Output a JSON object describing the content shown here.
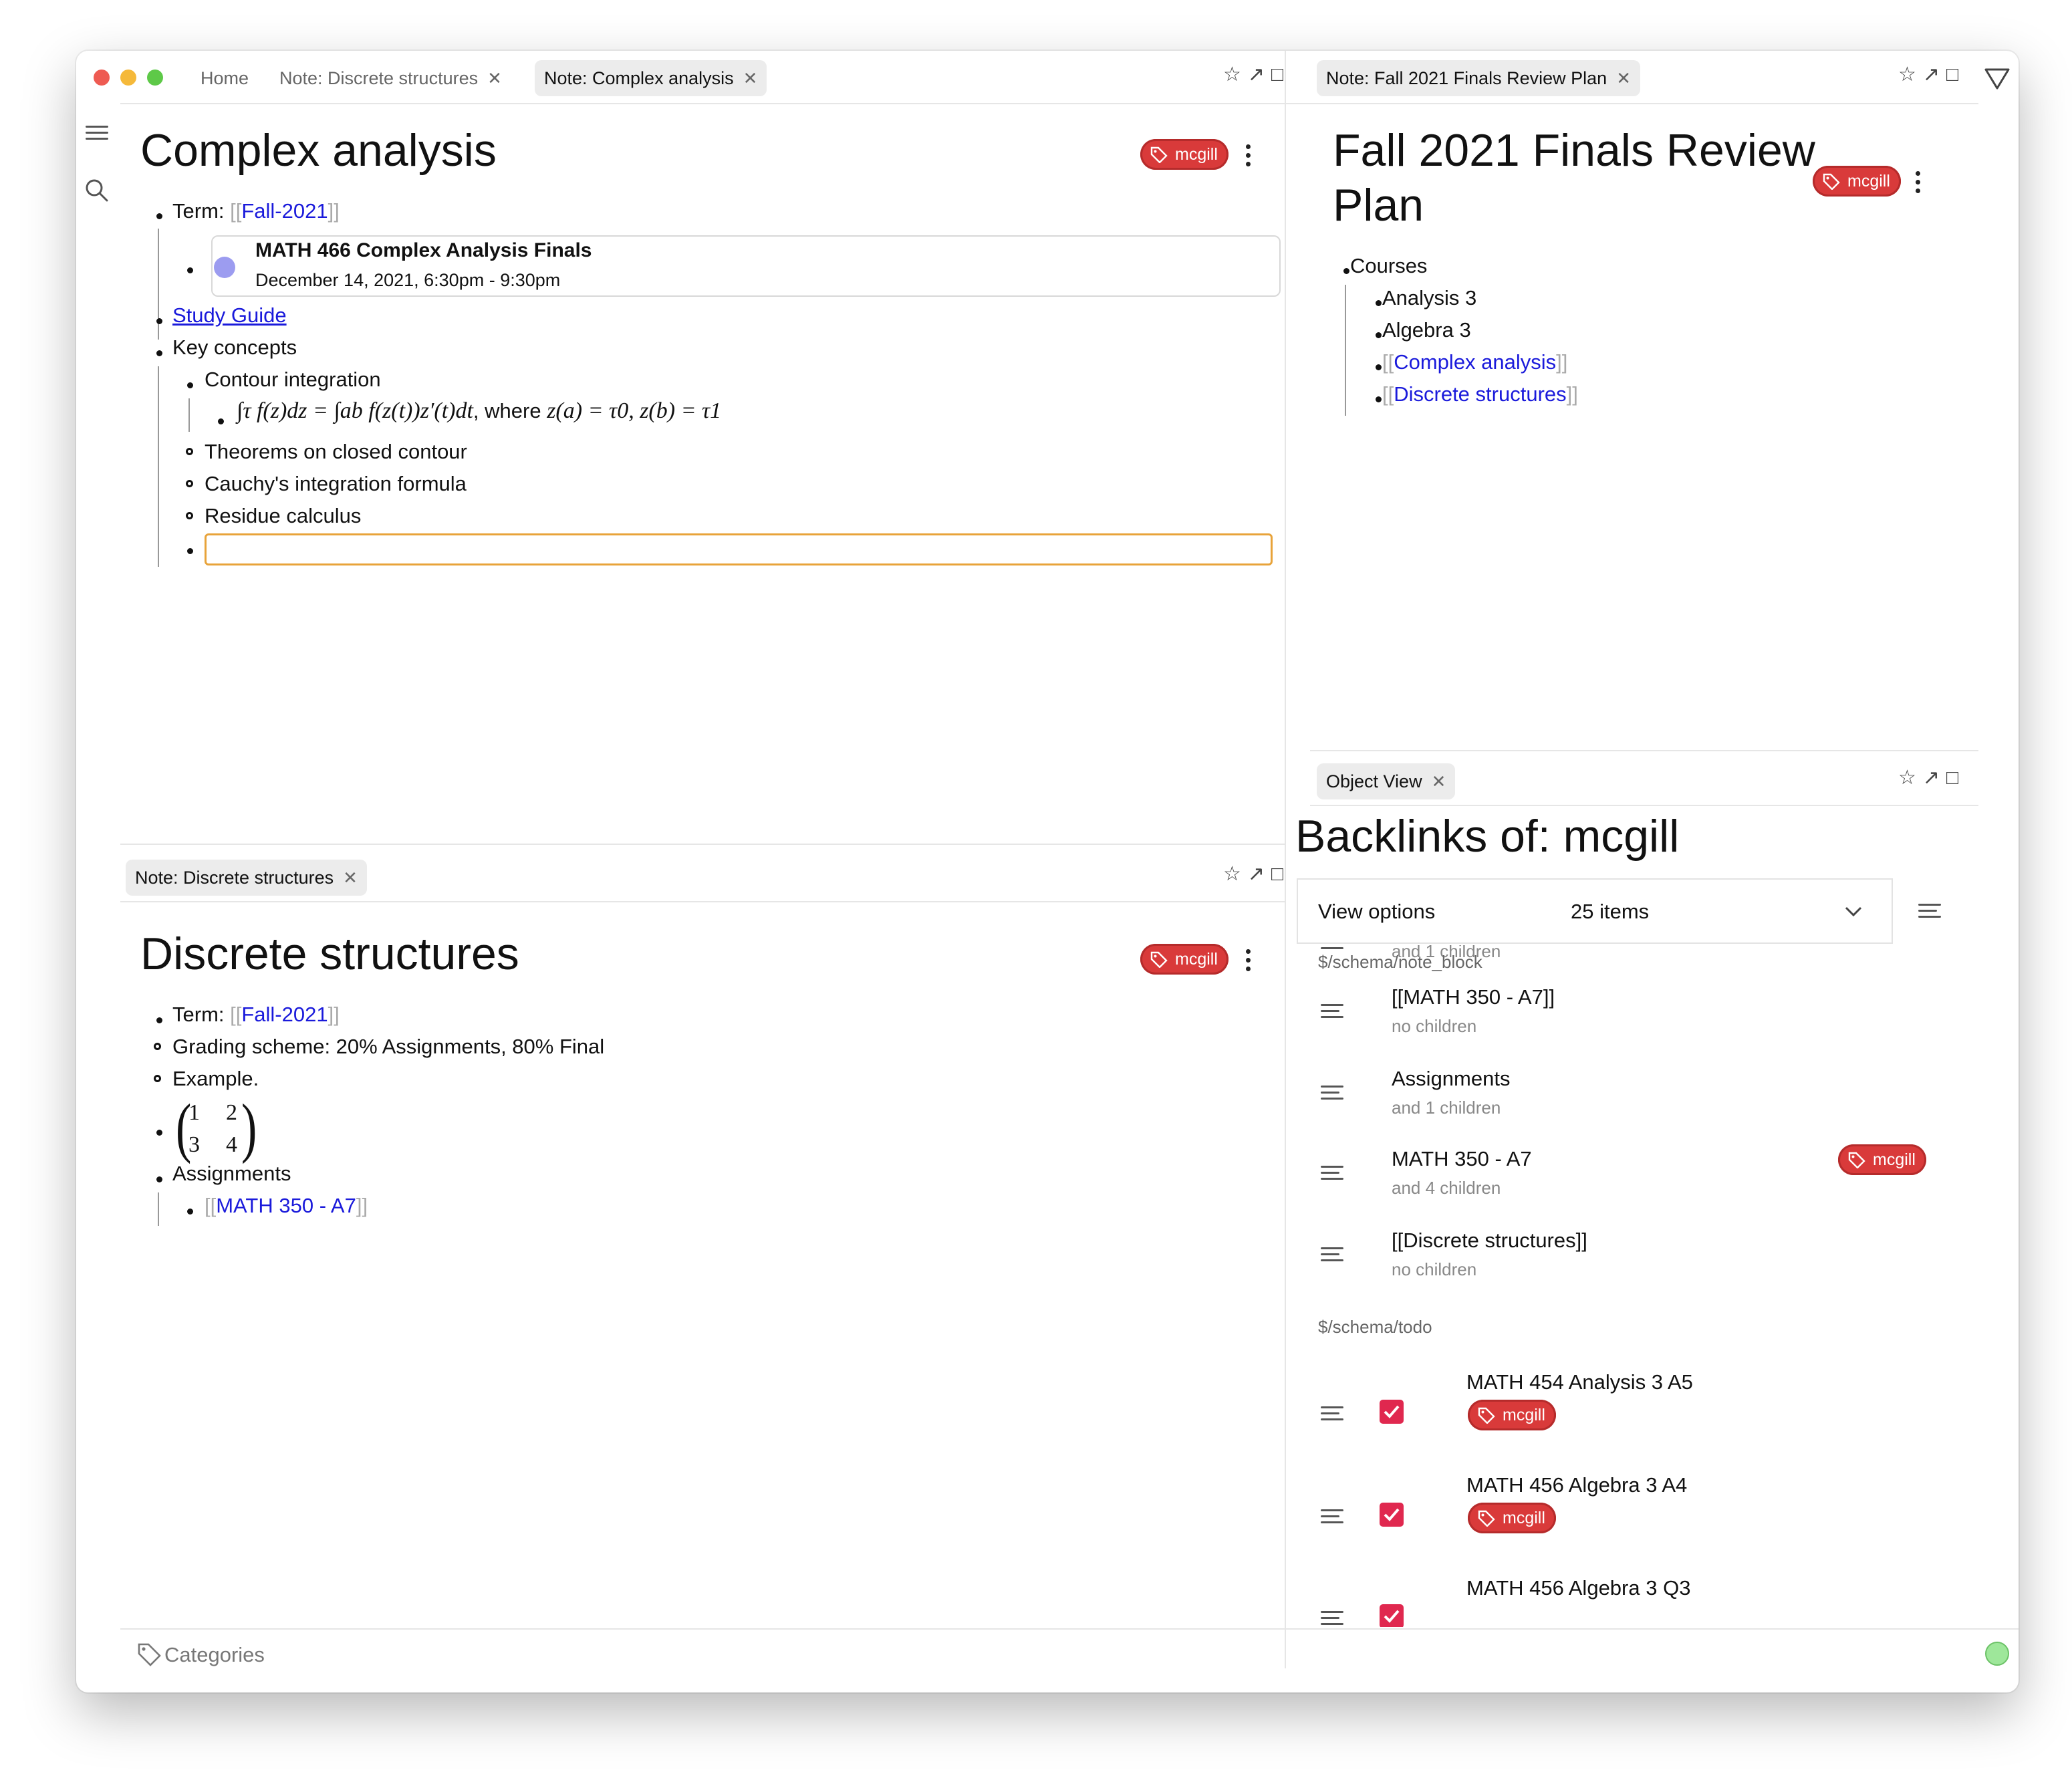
{
  "colors": {
    "tag_red": "#d93a3a",
    "link_blue": "#1a1adb",
    "focus_orange": "#e8a33a",
    "status_green": "#9ee79a",
    "event_dot": "#9c9cf0",
    "checkbox": "#e0284f"
  },
  "left_tabs": {
    "home": "Home",
    "discrete": "Note: Discrete structures",
    "complex": "Note: Complex analysis",
    "close": "✕"
  },
  "complex": {
    "title": "Complex analysis",
    "tag": "mcgill",
    "term_label": "Term: ",
    "term_link": "Fall-2021",
    "event_title": "MATH 466 Complex Analysis Finals",
    "event_time": "December 14, 2021, 6:30pm - 9:30pm",
    "study_guide": "Study Guide",
    "key_concepts": "Key concepts",
    "contour": "Contour integration",
    "formula_text": ", where ",
    "formula_lhs": "∫τ f(z)dz = ∫ab f(z(t))z′(t)dt",
    "formula_rhs": "z(a) = τ0, z(b) = τ1",
    "theorems": "Theorems on closed contour",
    "cauchy": "Cauchy's integration formula",
    "residue": "Residue calculus"
  },
  "discrete_tab": "Note: Discrete structures",
  "discrete": {
    "title": "Discrete structures",
    "tag": "mcgill",
    "term_label": "Term: ",
    "term_link": "Fall-2021",
    "grading": "Grading scheme: 20% Assignments, 80% Final",
    "example": "Example.",
    "matrix": [
      "1",
      "2",
      "3",
      "4"
    ],
    "assignments": "Assignments",
    "assignment_link": "MATH 350 - A7"
  },
  "fall_tab": "Note: Fall 2021 Finals Review Plan",
  "fall": {
    "title_line1": "Fall 2021 Finals Review",
    "title_line2": "Plan",
    "tag": "mcgill",
    "courses": "Courses",
    "analysis": "Analysis 3",
    "algebra": "Algebra 3",
    "complex_link": "Complex analysis",
    "discrete_link": "Discrete structures"
  },
  "object_tab": "Object View",
  "backlinks": {
    "title": "Backlinks of: mcgill",
    "view_options": "View options",
    "count": "25 items",
    "partial_children": "and 1 children",
    "group_note_block": "$/schema/note_block",
    "group_todo": "$/schema/todo",
    "items": [
      {
        "title": "[[MATH 350 - A7]]",
        "sub": "no children"
      },
      {
        "title": "Assignments",
        "sub": "and 1 children"
      },
      {
        "title": "MATH 350 - A7",
        "sub": "and 4 children",
        "tag": "mcgill"
      },
      {
        "title": "[[Discrete structures]]",
        "sub": "no children"
      }
    ],
    "todos": [
      {
        "title": "MATH 454 Analysis 3 A5",
        "tag": "mcgill"
      },
      {
        "title": "MATH 456 Algebra 3 A4",
        "tag": "mcgill"
      },
      {
        "title": "MATH 456 Algebra 3 Q3"
      }
    ]
  },
  "footer": {
    "categories": "Categories"
  },
  "icons": {
    "menu": "hamburger-icon",
    "search": "search-icon",
    "star": "☆",
    "arrow": "↗",
    "square": "□",
    "filter": "▽"
  }
}
